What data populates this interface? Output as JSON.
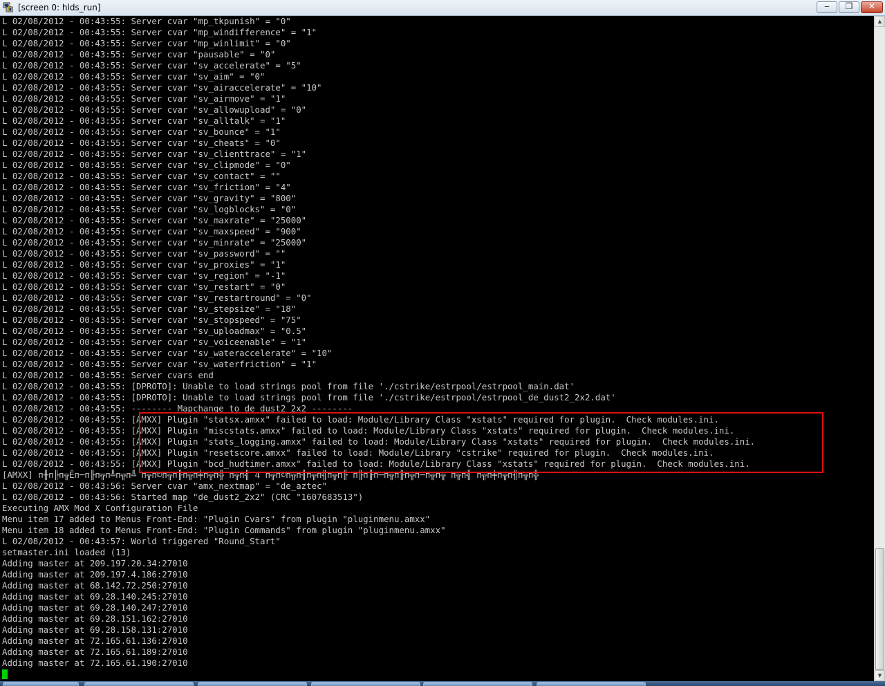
{
  "window": {
    "title": "[screen 0: hlds_run]",
    "icon": "putty-icon",
    "buttons": {
      "minimize": "‒",
      "maximize": "❐",
      "close": "✕"
    }
  },
  "colors": {
    "terminal_bg": "#000000",
    "terminal_text": "#c8c8c8",
    "cursor": "#00d000",
    "highlight_border": "#e01010"
  },
  "terminal": {
    "lines": [
      "L 02/08/2012 - 00:43:55: Server cvar \"mp_tkpunish\" = \"0\"",
      "L 02/08/2012 - 00:43:55: Server cvar \"mp_windifference\" = \"1\"",
      "L 02/08/2012 - 00:43:55: Server cvar \"mp_winlimit\" = \"0\"",
      "L 02/08/2012 - 00:43:55: Server cvar \"pausable\" = \"0\"",
      "L 02/08/2012 - 00:43:55: Server cvar \"sv_accelerate\" = \"5\"",
      "L 02/08/2012 - 00:43:55: Server cvar \"sv_aim\" = \"0\"",
      "L 02/08/2012 - 00:43:55: Server cvar \"sv_airaccelerate\" = \"10\"",
      "L 02/08/2012 - 00:43:55: Server cvar \"sv_airmove\" = \"1\"",
      "L 02/08/2012 - 00:43:55: Server cvar \"sv_allowupload\" = \"0\"",
      "L 02/08/2012 - 00:43:55: Server cvar \"sv_alltalk\" = \"1\"",
      "L 02/08/2012 - 00:43:55: Server cvar \"sv_bounce\" = \"1\"",
      "L 02/08/2012 - 00:43:55: Server cvar \"sv_cheats\" = \"0\"",
      "L 02/08/2012 - 00:43:55: Server cvar \"sv_clienttrace\" = \"1\"",
      "L 02/08/2012 - 00:43:55: Server cvar \"sv_clipmode\" = \"0\"",
      "L 02/08/2012 - 00:43:55: Server cvar \"sv_contact\" = \"\"",
      "L 02/08/2012 - 00:43:55: Server cvar \"sv_friction\" = \"4\"",
      "L 02/08/2012 - 00:43:55: Server cvar \"sv_gravity\" = \"800\"",
      "L 02/08/2012 - 00:43:55: Server cvar \"sv_logblocks\" = \"0\"",
      "L 02/08/2012 - 00:43:55: Server cvar \"sv_maxrate\" = \"25000\"",
      "L 02/08/2012 - 00:43:55: Server cvar \"sv_maxspeed\" = \"900\"",
      "L 02/08/2012 - 00:43:55: Server cvar \"sv_minrate\" = \"25000\"",
      "L 02/08/2012 - 00:43:55: Server cvar \"sv_password\" = \"\"",
      "L 02/08/2012 - 00:43:55: Server cvar \"sv_proxies\" = \"1\"",
      "L 02/08/2012 - 00:43:55: Server cvar \"sv_region\" = \"-1\"",
      "L 02/08/2012 - 00:43:55: Server cvar \"sv_restart\" = \"0\"",
      "L 02/08/2012 - 00:43:55: Server cvar \"sv_restartround\" = \"0\"",
      "L 02/08/2012 - 00:43:55: Server cvar \"sv_stepsize\" = \"18\"",
      "L 02/08/2012 - 00:43:55: Server cvar \"sv_stopspeed\" = \"75\"",
      "L 02/08/2012 - 00:43:55: Server cvar \"sv_uploadmax\" = \"0.5\"",
      "L 02/08/2012 - 00:43:55: Server cvar \"sv_voiceenable\" = \"1\"",
      "L 02/08/2012 - 00:43:55: Server cvar \"sv_wateraccelerate\" = \"10\"",
      "L 02/08/2012 - 00:43:55: Server cvar \"sv_waterfriction\" = \"1\"",
      "L 02/08/2012 - 00:43:55: Server cvars end",
      "L 02/08/2012 - 00:43:55: [DPROTO]: Unable to load strings pool from file './cstrike/estrpool/estrpool_main.dat'",
      "L 02/08/2012 - 00:43:55: [DPROTO]: Unable to load strings pool from file './cstrike/estrpool/estrpool_de_dust2_2x2.dat'",
      "L 02/08/2012 - 00:43:55: -------- Mapchange to de_dust2_2x2 --------",
      "L 02/08/2012 - 00:43:55: [AMXX] Plugin \"statsx.amxx\" failed to load: Module/Library Class \"xstats\" required for plugin.  Check modules.ini.",
      "L 02/08/2012 - 00:43:55: [AMXX] Plugin \"miscstats.amxx\" failed to load: Module/Library Class \"xstats\" required for plugin.  Check modules.ini.",
      "L 02/08/2012 - 00:43:55: [AMXX] Plugin \"stats_logging.amxx\" failed to load: Module/Library Class \"xstats\" required for plugin.  Check modules.ini.",
      "L 02/08/2012 - 00:43:55: [AMXX] Plugin \"resetscore.amxx\" failed to load: Module/Library \"cstrike\" required for plugin.  Check modules.ini.",
      "L 02/08/2012 - 00:43:55: [AMXX] Plugin \"bcd_hudtimer.amxx\" failed to load: Module/Library Class \"xstats\" required for plugin.  Check modules.ini.",
      "[AMXX] п╫п╟п╦Ёп─п╟п╦п╩п╦п╩ п╦п©п╦п╟п╦п╪п╦п╬ п╦п╣ 4 п╦п©п╦п╢п╦п╣п╦п╟ п╟п╟п─п╦п╟п╦п─п╦п╦ п╦п╣ п╦п╪п╦п╢п╦п╬",
      "L 02/08/2012 - 00:43:56: Server cvar \"amx_nextmap\" = \"de_aztec\"",
      "L 02/08/2012 - 00:43:56: Started map \"de_dust2_2x2\" (CRC \"1607683513\")",
      "Executing AMX Mod X Configuration File",
      "Menu item 17 added to Menus Front-End: \"Plugin Cvars\" from plugin \"pluginmenu.amxx\"",
      "Menu item 18 added to Menus Front-End: \"Plugin Commands\" from plugin \"pluginmenu.amxx\"",
      "L 02/08/2012 - 00:43:57: World triggered \"Round_Start\"",
      "setmaster.ini loaded (13)",
      "Adding master at 209.197.20.34:27010",
      "Adding master at 209.197.4.186:27010",
      "Adding master at 68.142.72.250:27010",
      "Adding master at 69.28.140.245:27010",
      "Adding master at 69.28.140.247:27010",
      "Adding master at 69.28.151.162:27010",
      "Adding master at 69.28.158.131:27010",
      "Adding master at 72.165.61.136:27010",
      "Adding master at 72.165.61.189:27010",
      "Adding master at 72.165.61.190:27010"
    ]
  },
  "scrollbar": {
    "up_icon": "▲",
    "down_icon": "▼"
  }
}
